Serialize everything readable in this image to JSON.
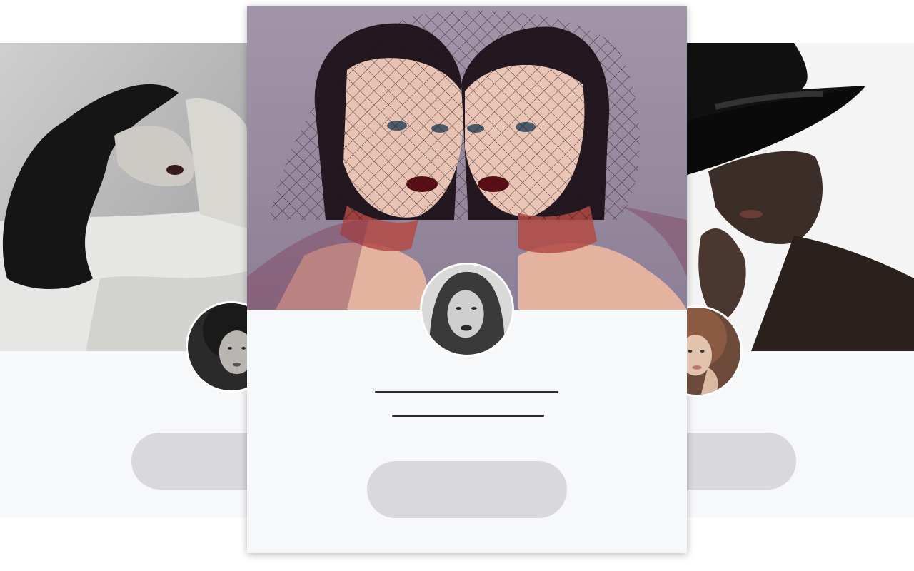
{
  "cards": {
    "left": {
      "photo_icon": "portrait-woman-lying-bw",
      "avatar_icon": "avatar-woman-curly-hair"
    },
    "center": {
      "photo_icon": "portrait-two-women-veils",
      "avatar_icon": "avatar-woman-dark-lips"
    },
    "right": {
      "photo_icon": "portrait-man-black-hat",
      "avatar_icon": "avatar-girl-hand-on-face"
    }
  },
  "colors": {
    "card_background": "#f7f8fa",
    "skeleton_line": "#2a2a2e",
    "skeleton_button": "#d9d9dc",
    "center_photo_background": "#9c8fa3"
  }
}
